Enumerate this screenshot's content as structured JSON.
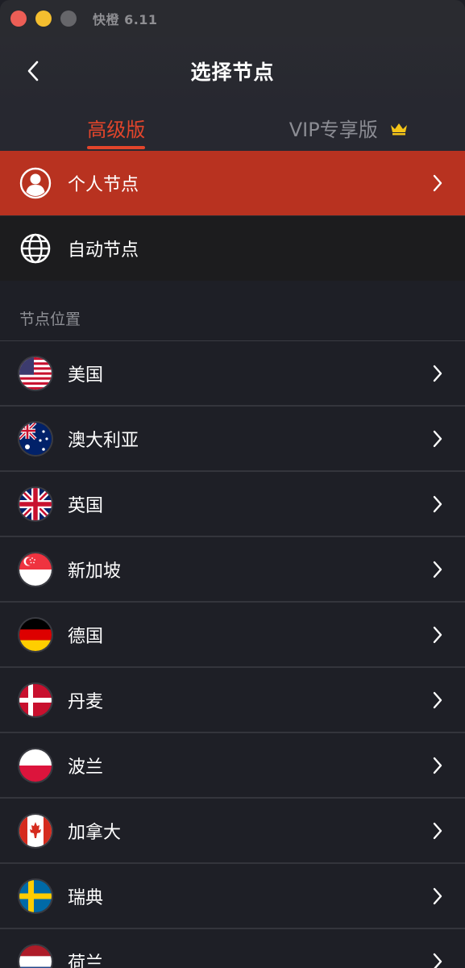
{
  "window": {
    "title": "快橙 6.11"
  },
  "header": {
    "title": "选择节点"
  },
  "tabs": [
    {
      "label": "高级版",
      "active": true
    },
    {
      "label": "VIP专享版",
      "active": false
    }
  ],
  "special": {
    "personal": {
      "label": "个人节点"
    },
    "auto": {
      "label": "自动节点"
    }
  },
  "section": {
    "title": "节点位置"
  },
  "countries": [
    {
      "name": "美国",
      "flag": "us-flag"
    },
    {
      "name": "澳大利亚",
      "flag": "au-flag"
    },
    {
      "name": "英国",
      "flag": "gb-flag"
    },
    {
      "name": "新加坡",
      "flag": "sg-flag"
    },
    {
      "name": "德国",
      "flag": "de-flag"
    },
    {
      "name": "丹麦",
      "flag": "dk-flag"
    },
    {
      "name": "波兰",
      "flag": "pl-flag"
    },
    {
      "name": "加拿大",
      "flag": "ca-flag"
    },
    {
      "name": "瑞典",
      "flag": "se-flag"
    },
    {
      "name": "荷兰",
      "flag": "nl-flag"
    }
  ],
  "colors": {
    "accent": "#e2452b",
    "personal_row": "#b83220",
    "background": "#1e1f26",
    "crown": "#f5c518"
  }
}
